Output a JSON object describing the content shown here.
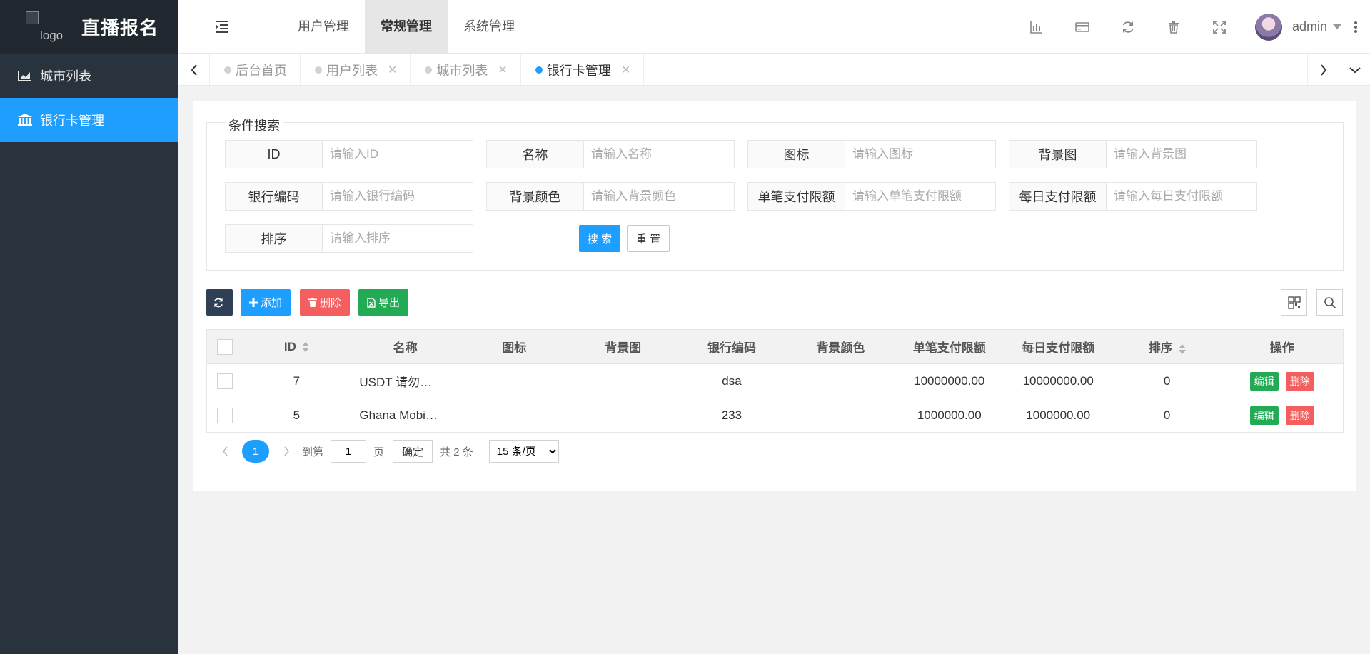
{
  "app": {
    "title": "直播报名",
    "logo_alt": "logo"
  },
  "sidebar": {
    "items": [
      {
        "label": "城市列表",
        "icon": "area-chart-icon",
        "active": false
      },
      {
        "label": "银行卡管理",
        "icon": "bank-icon",
        "active": true
      }
    ]
  },
  "header": {
    "nav": [
      {
        "label": "用户管理",
        "active": false
      },
      {
        "label": "常规管理",
        "active": true
      },
      {
        "label": "系统管理",
        "active": false
      }
    ],
    "tools": [
      "bar-chart-icon",
      "credit-card-icon",
      "refresh-icon",
      "trash-icon",
      "fullscreen-icon"
    ],
    "username": "admin"
  },
  "tabs": [
    {
      "label": "后台首页",
      "closable": false,
      "active": false
    },
    {
      "label": "用户列表",
      "closable": true,
      "active": false
    },
    {
      "label": "城市列表",
      "closable": true,
      "active": false
    },
    {
      "label": "银行卡管理",
      "closable": true,
      "active": true
    }
  ],
  "search": {
    "legend": "条件搜索",
    "fields": [
      {
        "label": "ID",
        "placeholder": "请输入ID"
      },
      {
        "label": "名称",
        "placeholder": "请输入名称"
      },
      {
        "label": "图标",
        "placeholder": "请输入图标"
      },
      {
        "label": "背景图",
        "placeholder": "请输入背景图"
      },
      {
        "label": "银行编码",
        "placeholder": "请输入银行编码"
      },
      {
        "label": "背景颜色",
        "placeholder": "请输入背景颜色"
      },
      {
        "label": "单笔支付限额",
        "placeholder": "请输入单笔支付限额"
      },
      {
        "label": "每日支付限额",
        "placeholder": "请输入每日支付限额"
      },
      {
        "label": "排序",
        "placeholder": "请输入排序"
      }
    ],
    "search_label": "搜 索",
    "reset_label": "重 置"
  },
  "toolbar": {
    "add_label": "添加",
    "delete_label": "删除",
    "export_label": "导出"
  },
  "table": {
    "columns": [
      "ID",
      "名称",
      "图标",
      "背景图",
      "银行编码",
      "背景颜色",
      "单笔支付限额",
      "每日支付限额",
      "排序",
      "操作"
    ],
    "rows": [
      {
        "id": "7",
        "name": "USDT 请勿…",
        "icon": "",
        "bg_image": "",
        "code": "dsa",
        "bg_color": "",
        "single_limit": "10000000.00",
        "daily_limit": "10000000.00",
        "sort": "0"
      },
      {
        "id": "5",
        "name": "Ghana Mobi…",
        "icon": "",
        "bg_image": "",
        "code": "233",
        "bg_color": "",
        "single_limit": "1000000.00",
        "daily_limit": "1000000.00",
        "sort": "0"
      }
    ],
    "edit_label": "编辑",
    "delete_label": "删除"
  },
  "pager": {
    "current": "1",
    "goto_prefix": "到第",
    "goto_value": "1",
    "goto_suffix": "页",
    "confirm_label": "确定",
    "total_text": "共 2 条",
    "page_size": "15 条/页"
  },
  "colors": {
    "sidebar_bg": "#28333e",
    "accent": "#1e9fff",
    "success": "#22aa55",
    "danger": "#f45e5e",
    "dark_button": "#2f4056"
  }
}
